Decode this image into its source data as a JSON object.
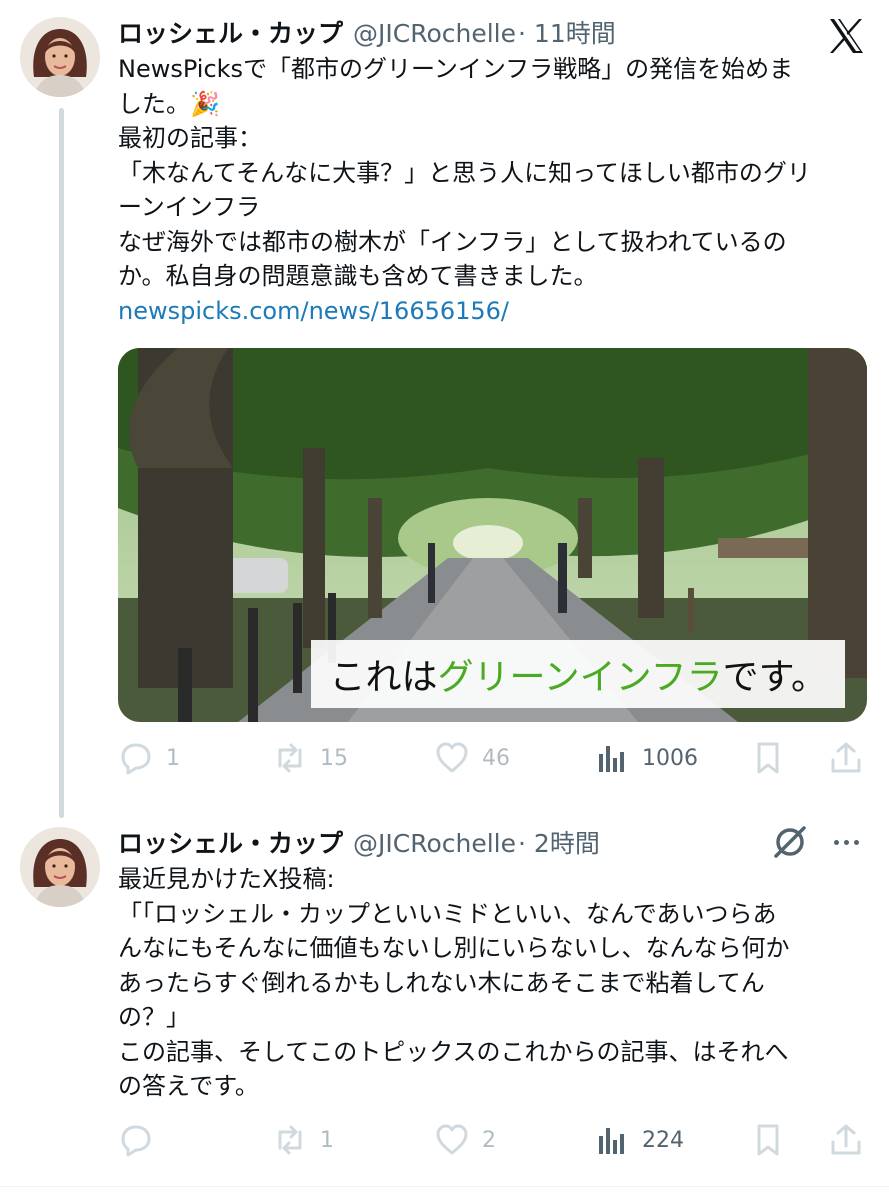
{
  "tweet1": {
    "name": "ロッシェル・カップ",
    "handle": "@JICRochelle",
    "time": "· 11時間",
    "lines": [
      "NewsPicksで「都市のグリーンインフラ戦略」の発信を始めま",
      "した。🎉",
      "最初の記事：",
      "「木なんてそんなに大事？」と思う人に知ってほしい都市のグリ",
      "ーンインフラ",
      "なぜ海外では都市の樹木が「インフラ」として扱われているの",
      "か。私自身の問題意識も含めて書きました。"
    ],
    "link": "newspicks.com/news/16656156/",
    "image_caption_prefix": "これは",
    "image_caption_highlight": "グリーンインフラ",
    "image_caption_suffix": "です。",
    "replies": "1",
    "reposts": "15",
    "likes": "46",
    "views": "1006"
  },
  "tweet2": {
    "name": "ロッシェル・カップ",
    "handle": "@JICRochelle",
    "time": "· 2時間",
    "lines": [
      "最近見かけたX投稿:",
      "「「ロッシェル・カップといいミドといい、なんであいつらあ",
      "んなにもそんなに価値もないし別にいらないし、なんなら何か",
      "あったらすぐ倒れるかもしれない木にあそこまで粘着してん",
      "の？」",
      "この記事、そしてこのトピックスのこれからの記事、はそれへ",
      "の答えです。"
    ],
    "replies": "",
    "reposts": "1",
    "likes": "2",
    "views": "224"
  },
  "icons": {
    "logo": "x-logo-icon",
    "reply": "reply-icon",
    "repost": "repost-icon",
    "like": "like-icon",
    "views": "views-icon",
    "bookmark": "bookmark-icon",
    "share": "share-icon",
    "no_translation": "slashed-circle-icon",
    "more": "more-icon"
  },
  "colors": {
    "text": "#0f1419",
    "secondary": "#536471",
    "link": "#1d7ab8",
    "thread_line": "#cfd9de",
    "caption_green": "#4aaa22"
  }
}
